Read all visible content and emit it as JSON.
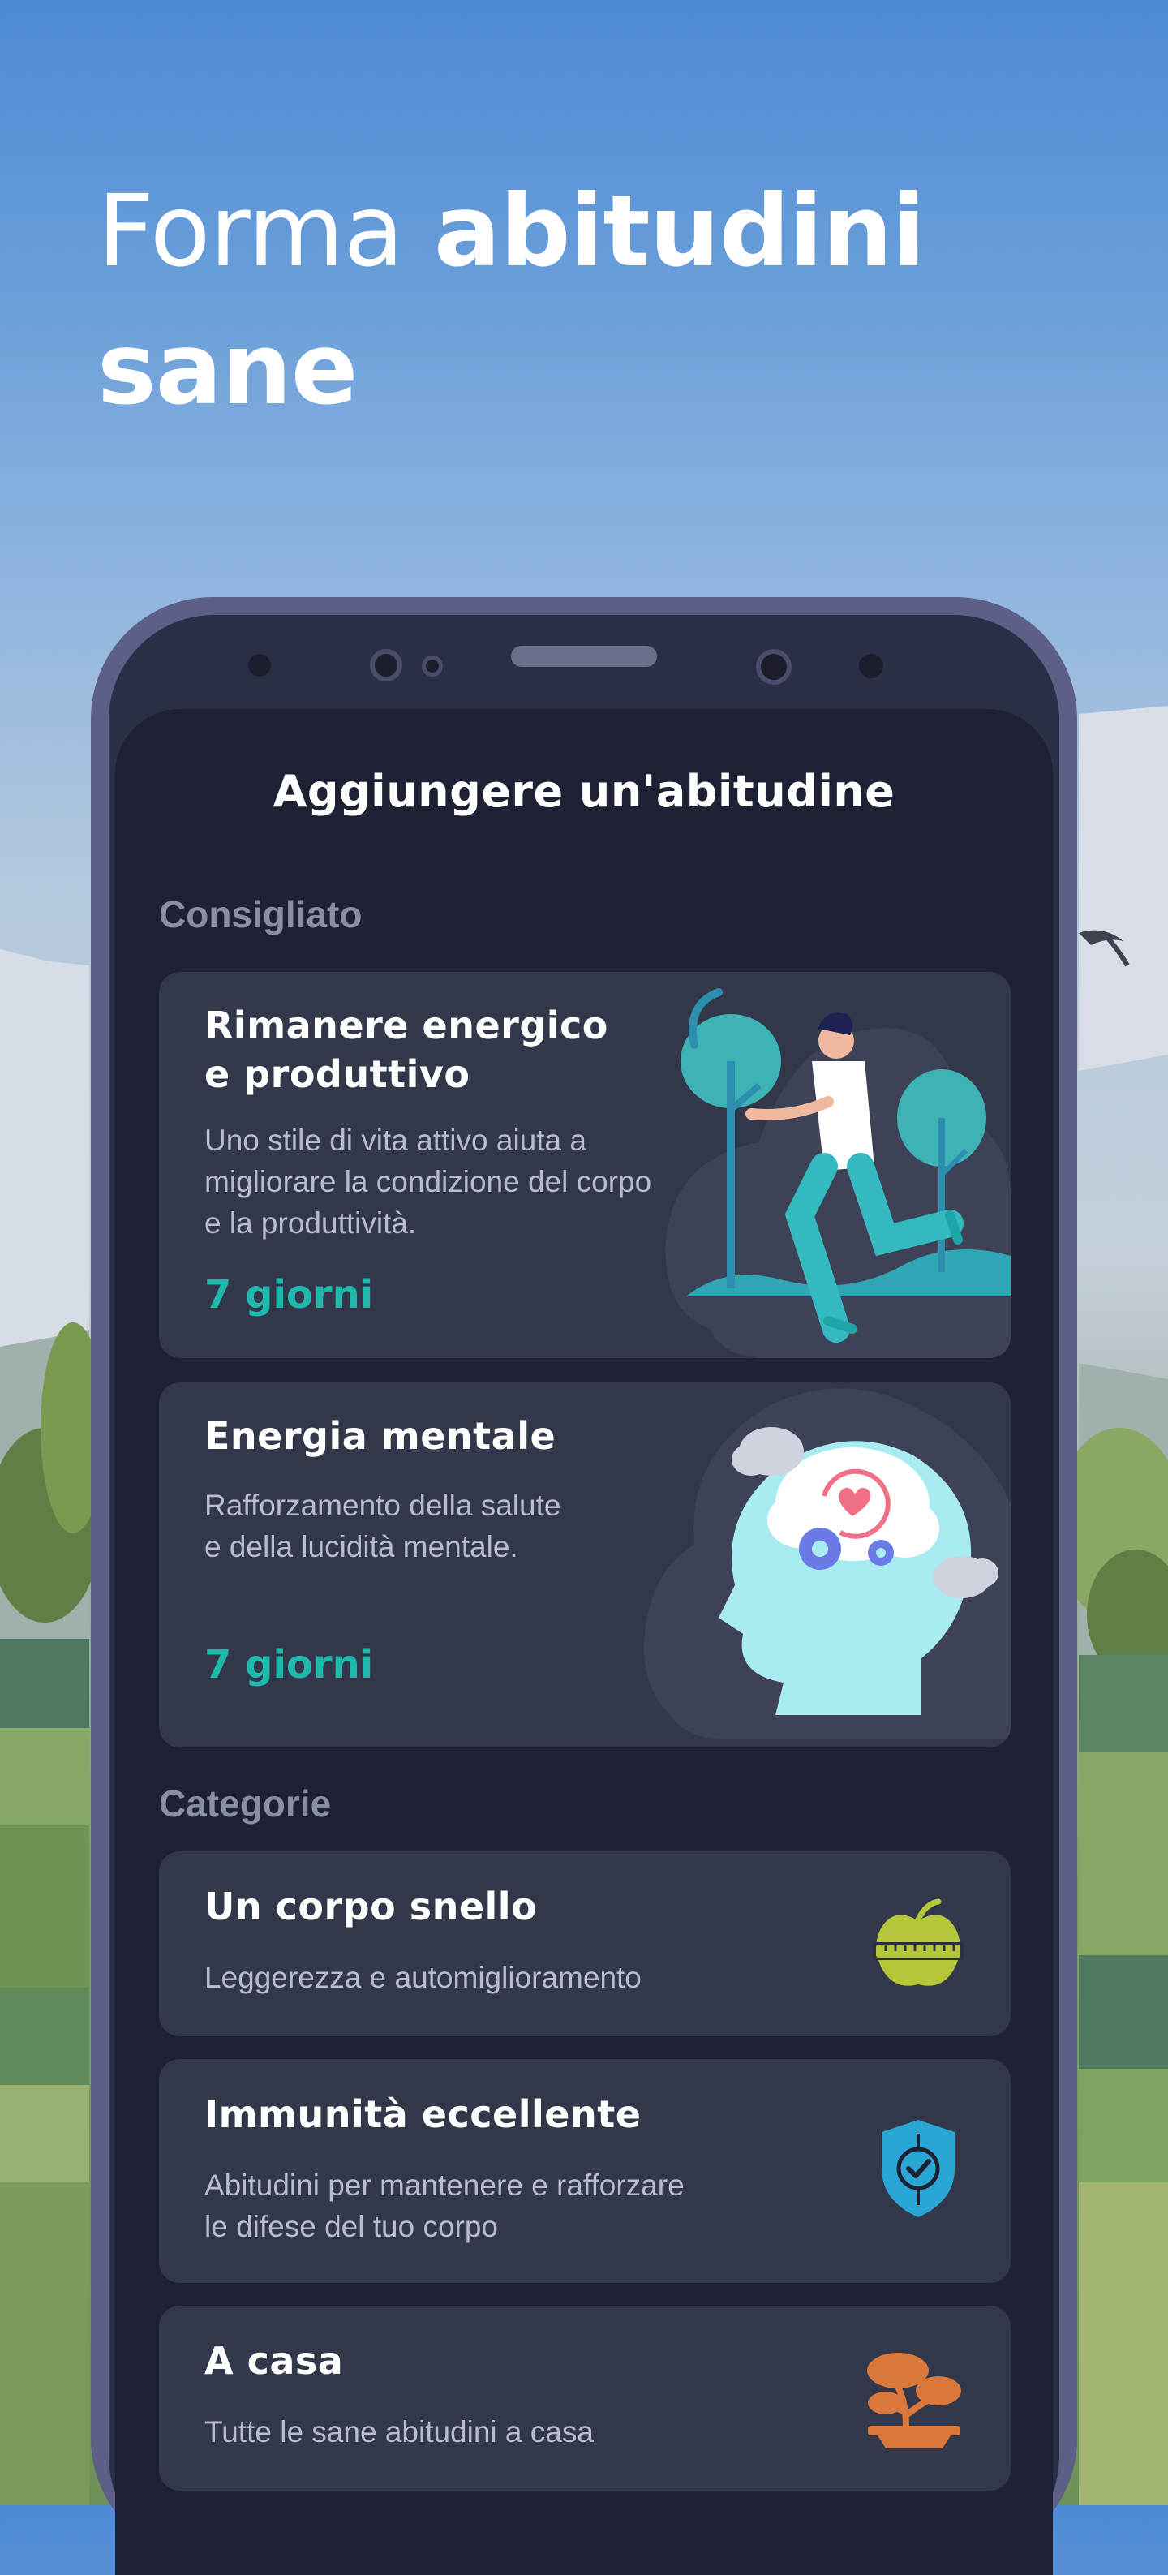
{
  "headline": {
    "line_light": "Forma ",
    "line_bold_1": "abitudini",
    "line_bold_2": "sane"
  },
  "screen": {
    "title": "Aggiungere un'abitudine",
    "recommended_label": "Consigliato",
    "categories_label": "Categorie",
    "recommended": [
      {
        "title": "Rimanere energico\ne produttivo",
        "description": "Uno stile di vita attivo aiuta a\nmigliorare la condizione del corpo\ne la produttività.",
        "duration": "7 giorni",
        "illustration": "runner-illustration"
      },
      {
        "title": "Energia mentale",
        "description": "Rafforzamento della salute\ne della lucidità mentale.",
        "duration": "7 giorni",
        "illustration": "mind-head-illustration"
      }
    ],
    "categories": [
      {
        "title": "Un corpo snello",
        "description": "Leggerezza e automiglioramento",
        "icon": "apple-measuring-tape-icon",
        "icon_color": "#b5c63a"
      },
      {
        "title": "Immunità eccellente",
        "description": "Abitudini per mantenere e rafforzare\nle difese del tuo corpo",
        "icon": "shield-check-icon",
        "icon_color": "#2aa6d4"
      },
      {
        "title": "A casa",
        "description": "Tutte le sane abitudini a casa",
        "icon": "bonsai-icon",
        "icon_color": "#d9783a"
      }
    ]
  },
  "colors": {
    "screen_bg": "#1e2133",
    "card_bg": "#33374a",
    "accent_teal": "#1fb8ac",
    "phone_frame": "#5d5f86"
  }
}
